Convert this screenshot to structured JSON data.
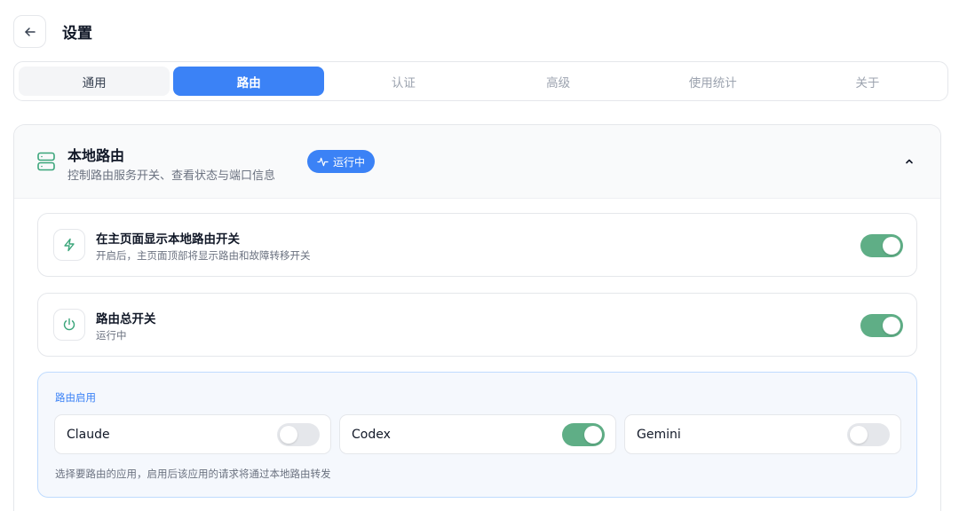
{
  "header": {
    "title": "设置"
  },
  "tabs": [
    {
      "label": "通用"
    },
    {
      "label": "路由"
    },
    {
      "label": "认证"
    },
    {
      "label": "高级"
    },
    {
      "label": "使用统计"
    },
    {
      "label": "关于"
    }
  ],
  "active_tab": "路由",
  "local_router": {
    "title": "本地路由",
    "subtitle": "控制路由服务开关、查看状态与端口信息",
    "status_badge": "运行中",
    "expanded": true
  },
  "settings": [
    {
      "title": "在主页面显示本地路由开关",
      "description": "开启后，主页面顶部将显示路由和故障转移开关",
      "enabled": true,
      "icon": "lightning-icon"
    },
    {
      "title": "路由总开关",
      "description": "运行中",
      "enabled": true,
      "icon": "power-icon"
    }
  ],
  "router_apps": {
    "label": "路由启用",
    "apps": [
      {
        "name": "Claude",
        "enabled": false
      },
      {
        "name": "Codex",
        "enabled": true
      },
      {
        "name": "Gemini",
        "enabled": false
      }
    ],
    "note": "选择要路由的应用，启用后该应用的请求将通过本地路由转发"
  },
  "colors": {
    "accent": "#3b82f6",
    "toggle_on": "#5fae86",
    "toggle_off": "#e5e7eb"
  }
}
